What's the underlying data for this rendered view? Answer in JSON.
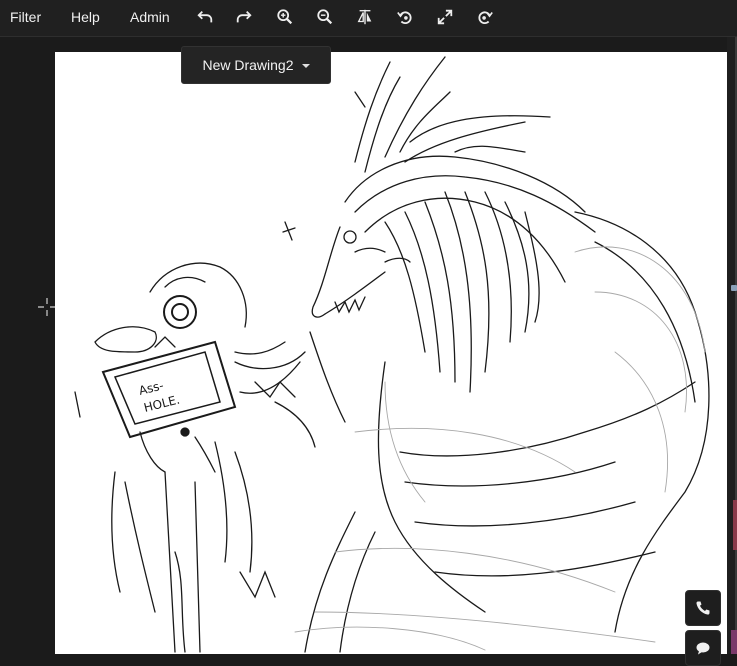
{
  "menu": {
    "filter": "Filter",
    "help": "Help",
    "admin": "Admin"
  },
  "toolbar": {
    "icons": [
      "undo-icon",
      "redo-icon",
      "zoom-in-icon",
      "zoom-out-icon",
      "flip-icon",
      "rotate-left-icon",
      "fullscreen-icon",
      "rotate-right-icon"
    ]
  },
  "document": {
    "title": "New Drawing2"
  },
  "colors": {
    "background": "#1b1b1b",
    "topbar": "#202020",
    "canvas": "#ffffff",
    "accent_right": "#8a3a4a"
  },
  "floating_buttons": {
    "icons": [
      "phone-icon",
      "chat-icon"
    ]
  }
}
